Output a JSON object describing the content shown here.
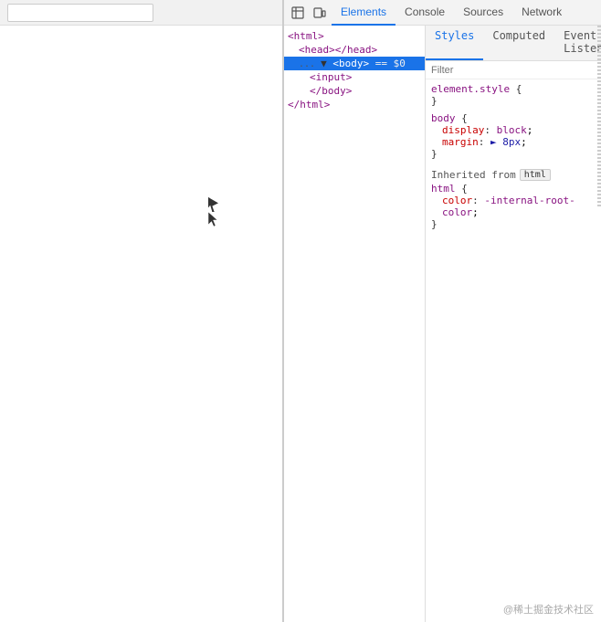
{
  "browser": {
    "address_bar_value": ""
  },
  "devtools": {
    "toolbar_icons": [
      {
        "name": "inspect-icon",
        "symbol": "⬚"
      },
      {
        "name": "device-icon",
        "symbol": "▭"
      }
    ],
    "tabs": [
      {
        "id": "elements",
        "label": "Elements",
        "active": true
      },
      {
        "id": "console",
        "label": "Console",
        "active": false
      },
      {
        "id": "sources",
        "label": "Sources",
        "active": false
      },
      {
        "id": "network",
        "label": "Network",
        "active": false
      }
    ],
    "elements_panel": {
      "lines": [
        {
          "id": "html-open",
          "indent": 0,
          "content": "<html>",
          "selected": false
        },
        {
          "id": "head",
          "indent": 1,
          "content": "<head></head>",
          "selected": false
        },
        {
          "id": "body",
          "indent": 1,
          "content": "▼ <body> == $0",
          "selected": true
        },
        {
          "id": "input",
          "indent": 2,
          "content": "<input>",
          "selected": false
        },
        {
          "id": "body-close",
          "indent": 2,
          "content": "</body>",
          "selected": false
        },
        {
          "id": "html-close",
          "indent": 0,
          "content": "</html>",
          "selected": false
        }
      ]
    },
    "styles_panel": {
      "subtabs": [
        {
          "id": "styles",
          "label": "Styles",
          "active": true
        },
        {
          "id": "computed",
          "label": "Computed",
          "active": false
        },
        {
          "id": "event-listeners",
          "label": "Event Listeners",
          "active": false
        }
      ],
      "filter_placeholder": "Filter",
      "rules": [
        {
          "id": "element-style",
          "selector": "element.style",
          "open_brace": "{",
          "close_brace": "}",
          "properties": []
        },
        {
          "id": "body-rule",
          "selector": "body",
          "open_brace": "{",
          "close_brace": "}",
          "properties": [
            {
              "name": "display",
              "colon": ":",
              "value": "block",
              "value_color": "purple"
            },
            {
              "name": "margin",
              "colon": ":",
              "value": "▶ 8px",
              "value_color": "blue"
            }
          ]
        },
        {
          "id": "inherited-from",
          "label": "Inherited from",
          "badge": "html"
        },
        {
          "id": "html-rule",
          "selector": "html",
          "open_brace": "{",
          "close_brace": "}",
          "properties": [
            {
              "name": "color",
              "colon": ":",
              "value": "-internal-root-color;",
              "value_color": "pink"
            }
          ]
        }
      ]
    }
  },
  "watermark": "@稀土掘金技术社区"
}
